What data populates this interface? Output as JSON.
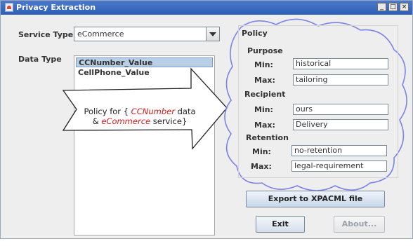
{
  "window": {
    "title": "Privacy Extraction",
    "controls": {
      "minimize": "_",
      "maximize": "□",
      "close": "×"
    }
  },
  "service_type": {
    "label": "Service Type",
    "selected": "eCommerce"
  },
  "data_type": {
    "label": "Data Type",
    "items": [
      {
        "label": "CCNumber_Value",
        "selected": true
      },
      {
        "label": "CellPhone_Value",
        "selected": false
      }
    ]
  },
  "callout": {
    "line1_prefix": "Policy for {",
    "data_term": "CCNumber",
    "line1_suffix": "data",
    "line2_prefix": "&",
    "service_term": "eCommerce",
    "line2_suffix": "service}"
  },
  "policy": {
    "title": "Policy",
    "sections": [
      {
        "heading": "Purpose",
        "min_label": "Min:",
        "min": "historical",
        "max_label": "Max:",
        "max": "tailoring"
      },
      {
        "heading": "Recipient",
        "min_label": "Min:",
        "min": "ours",
        "max_label": "Max:",
        "max": "Delivery"
      },
      {
        "heading": "Retention",
        "min_label": "Min:",
        "min": "no-retention",
        "max_label": "Max:",
        "max": "legal-requirement"
      }
    ]
  },
  "buttons": {
    "export": "Export to XPACML file",
    "exit": "Exit",
    "about": "About..."
  }
}
